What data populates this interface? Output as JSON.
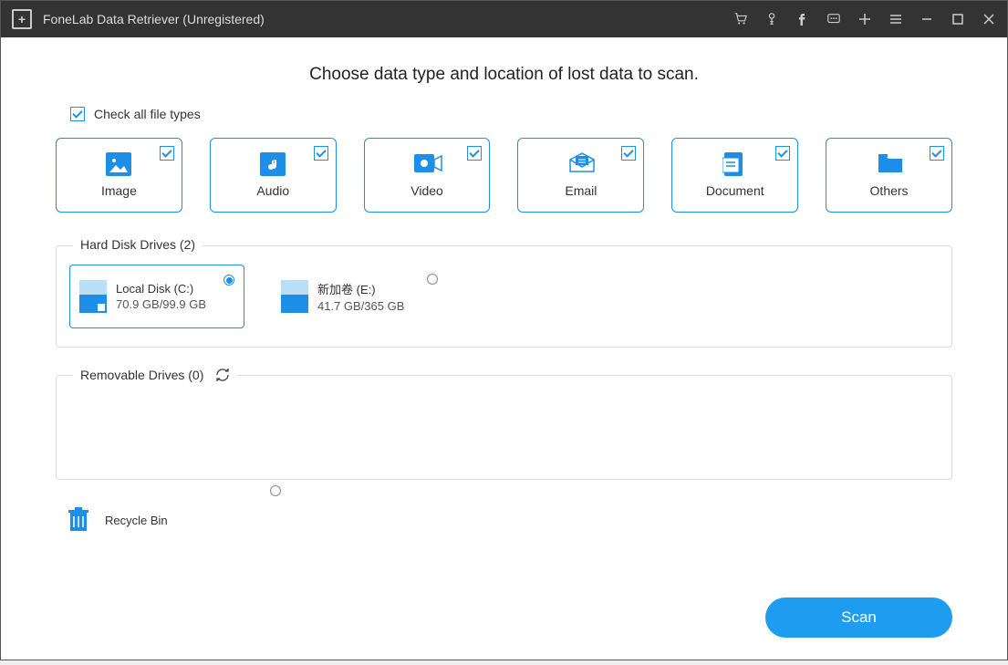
{
  "titlebar": {
    "app_title": "FoneLab Data Retriever (Unregistered)"
  },
  "heading": "Choose data type and location of lost data to scan.",
  "checkall_label": "Check all file types",
  "filetypes": [
    {
      "label": "Image",
      "icon": "image-icon"
    },
    {
      "label": "Audio",
      "icon": "audio-icon"
    },
    {
      "label": "Video",
      "icon": "video-icon"
    },
    {
      "label": "Email",
      "icon": "email-icon"
    },
    {
      "label": "Document",
      "icon": "document-icon"
    },
    {
      "label": "Others",
      "icon": "folder-icon"
    }
  ],
  "hdd_section": {
    "legend": "Hard Disk Drives (2)",
    "drives": [
      {
        "name": "Local Disk (C:)",
        "size": "70.9 GB/99.9 GB",
        "selected": true,
        "has_win": true
      },
      {
        "name": "新加卷 (E:)",
        "size": "41.7 GB/365 GB",
        "selected": false,
        "has_win": false
      }
    ]
  },
  "removable_section": {
    "legend": "Removable Drives (0)"
  },
  "recycle": {
    "label": "Recycle Bin"
  },
  "scan_label": "Scan"
}
